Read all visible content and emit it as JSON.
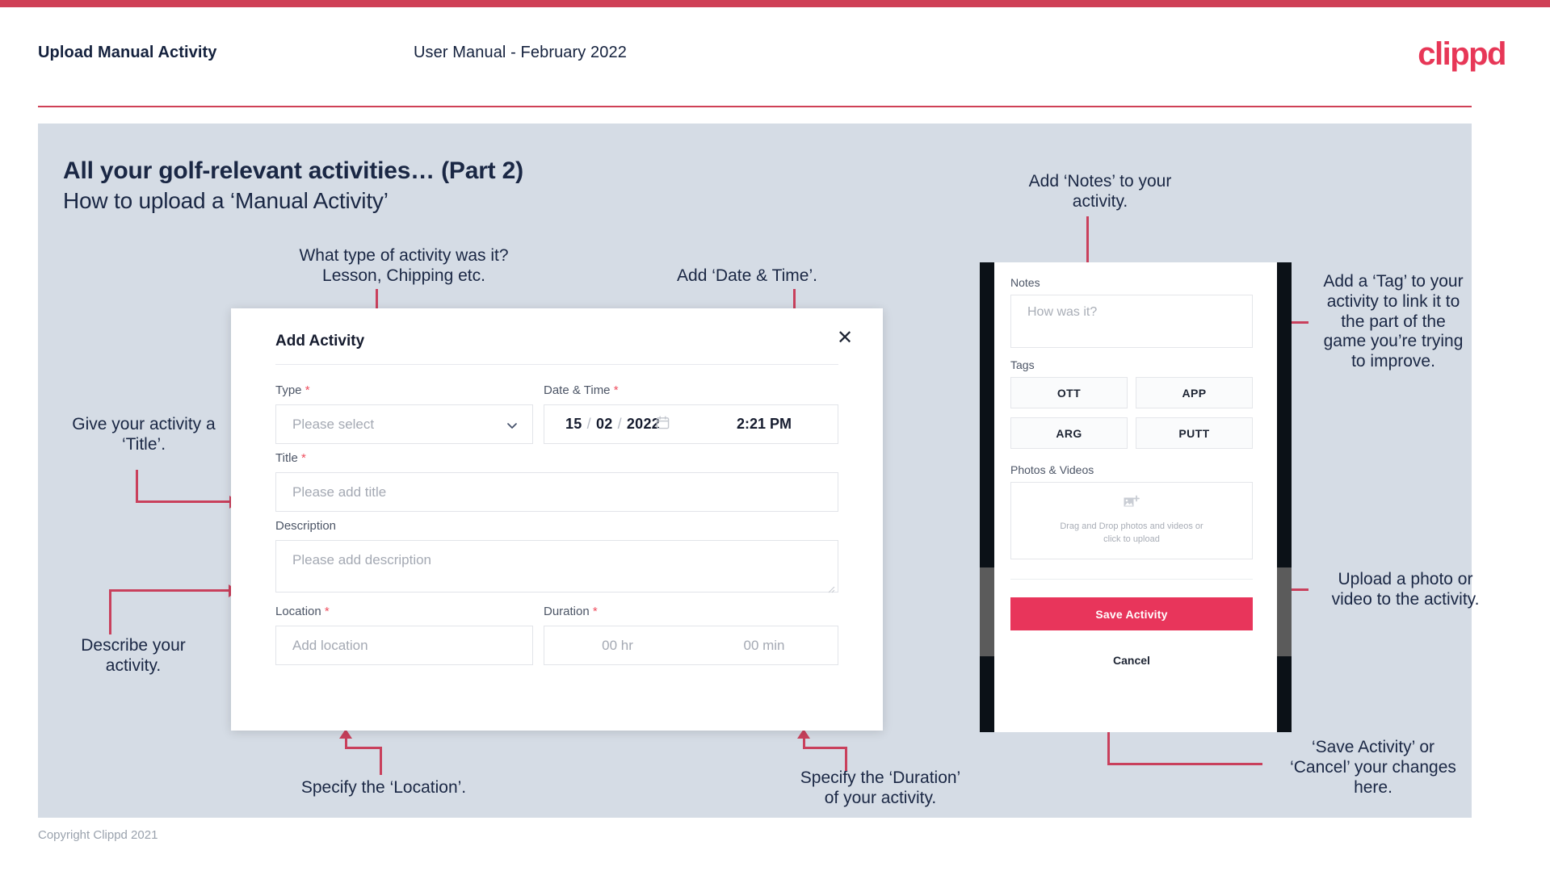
{
  "header": {
    "title": "Upload Manual Activity",
    "subtitle": "User Manual - February 2022",
    "logo": "clippd"
  },
  "slide": {
    "title": "All your golf-relevant activities… (Part 2)",
    "subtitle": "How to upload a ‘Manual Activity’",
    "copyright": "Copyright Clippd 2021"
  },
  "dialog": {
    "title": "Add Activity",
    "close_icon": "close-icon",
    "fields": {
      "type": {
        "label": "Type",
        "required": "*",
        "placeholder": "Please select",
        "chevron_icon": "chevron-down-icon"
      },
      "datetime": {
        "label": "Date & Time",
        "required": "*",
        "day": "15",
        "month": "02",
        "year": "2022",
        "separator": "/",
        "calendar_icon": "calendar-icon",
        "time": "2:21 PM"
      },
      "title": {
        "label": "Title",
        "required": "*",
        "placeholder": "Please add title"
      },
      "description": {
        "label": "Description",
        "required": "",
        "placeholder": "Please add description"
      },
      "location": {
        "label": "Location",
        "required": "*",
        "placeholder": "Add location"
      },
      "duration": {
        "label": "Duration",
        "required": "*",
        "hours_placeholder": "00 hr",
        "minutes_placeholder": "00 min"
      }
    }
  },
  "phone": {
    "notes": {
      "label": "Notes",
      "placeholder": "How was it?"
    },
    "tags": {
      "label": "Tags",
      "items": [
        {
          "label": "OTT"
        },
        {
          "label": "APP"
        },
        {
          "label": "ARG"
        },
        {
          "label": "PUTT"
        }
      ]
    },
    "photos": {
      "label": "Photos & Videos",
      "icon": "add-image-icon",
      "line1": "Drag and Drop photos and videos or",
      "line2": "click to upload"
    },
    "save_label": "Save Activity",
    "cancel_label": "Cancel"
  },
  "annotations": {
    "type": "What type of activity was it?\nLesson, Chipping etc.",
    "datetime": "Add ‘Date & Time’.",
    "title": "Give your activity a\n‘Title’.",
    "description": "Describe your\nactivity.",
    "location": "Specify the ‘Location’.",
    "duration": "Specify the ‘Duration’\nof your activity.",
    "notes": "Add ‘Notes’ to your\nactivity.",
    "tags": "Add a ‘Tag’ to your\nactivity to link it to\nthe part of the\ngame you’re trying\nto improve.",
    "photos": "Upload a photo or\nvideo to the activity.",
    "save_cancel": "‘Save Activity’ or\n‘Cancel’ your changes\nhere."
  },
  "colors": {
    "accent": "#e8355b",
    "bar": "#cf4056",
    "connector": "#c9405c",
    "slide_bg": "#d5dce5",
    "text_dark": "#1a2744"
  }
}
